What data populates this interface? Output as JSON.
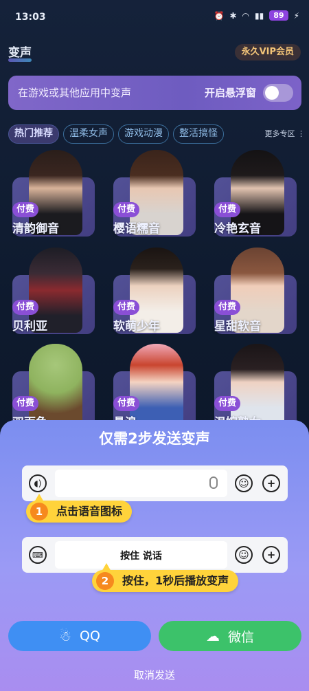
{
  "status_bar": {
    "time": "13:03",
    "battery": "89",
    "icons": [
      "alarm-icon",
      "bluetooth-icon",
      "wifi-icon",
      "signal-icon",
      "charging-icon"
    ]
  },
  "header": {
    "title": "变声",
    "vip_label": "永久VIP会员"
  },
  "float_bar": {
    "text": "在游戏或其他应用中变声",
    "label": "开启悬浮窗",
    "toggle_on": false
  },
  "tabs": {
    "items": [
      {
        "label": "热门推荐",
        "active": true
      },
      {
        "label": "温柔女声",
        "active": false
      },
      {
        "label": "游戏动漫",
        "active": false
      },
      {
        "label": "整活搞怪",
        "active": false
      }
    ],
    "more_label": "更多专区"
  },
  "voices": [
    {
      "badge": "付费",
      "name": "清韵御音"
    },
    {
      "badge": "付费",
      "name": "樱语糯音"
    },
    {
      "badge": "付费",
      "name": "冷艳玄音"
    },
    {
      "badge": "付费",
      "name": "贝利亚"
    },
    {
      "badge": "付费",
      "name": "软萌少年"
    },
    {
      "badge": "付费",
      "name": "星甜软音"
    },
    {
      "badge": "付费",
      "name": "双面龟"
    },
    {
      "badge": "付费",
      "name": "悬浪"
    },
    {
      "badge": "付费",
      "name": "温婉熟女"
    }
  ],
  "sheet": {
    "title": "仅需2步发送变声",
    "step1": {
      "num": "1",
      "text": "点击语音图标"
    },
    "step2": {
      "num": "2",
      "text": "按住，1秒后播放变声"
    },
    "hold_text": "按住 说话",
    "qq_label": "QQ",
    "wechat_label": "微信",
    "cancel_label": "取消发送"
  },
  "colors": {
    "qq": "#3f8ff3",
    "wechat": "#3cc26a",
    "tip": "#ffd33b",
    "paid": "#8a4fd6"
  }
}
